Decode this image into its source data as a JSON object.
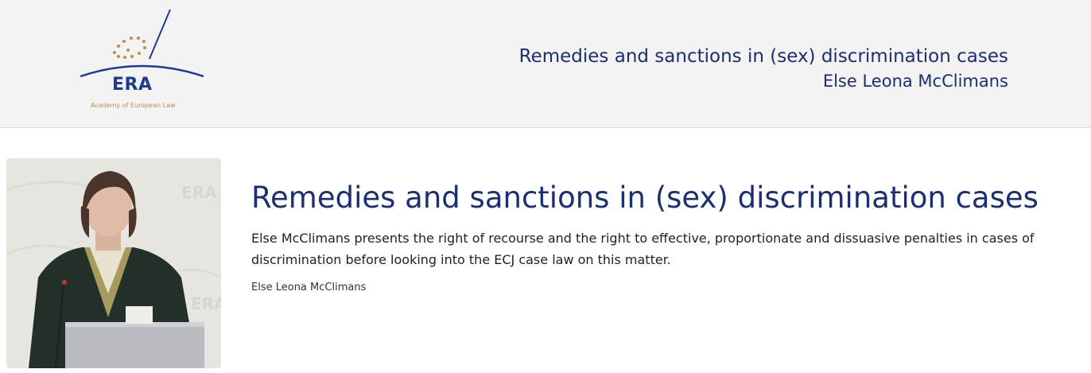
{
  "header": {
    "logo_text": "ERA",
    "logo_subtitle": "Academy of European Law",
    "title": "Remedies and sanctions in (sex) discrimination cases",
    "author": "Else Leona McClimans"
  },
  "main": {
    "title": "Remedies and sanctions in (sex) discrimination cases",
    "description": "Else McClimans presents the right of recourse and the right to effective, proportionate and dissuasive penalties in cases of discrimination before looking into the ECJ case law on this matter.",
    "speaker": "Else Leona McClimans",
    "photo_background_text": "ERA"
  },
  "colors": {
    "header_bg": "#f3f3f3",
    "brand_blue": "#1c2f6e",
    "logo_gold": "#c58a4f"
  }
}
